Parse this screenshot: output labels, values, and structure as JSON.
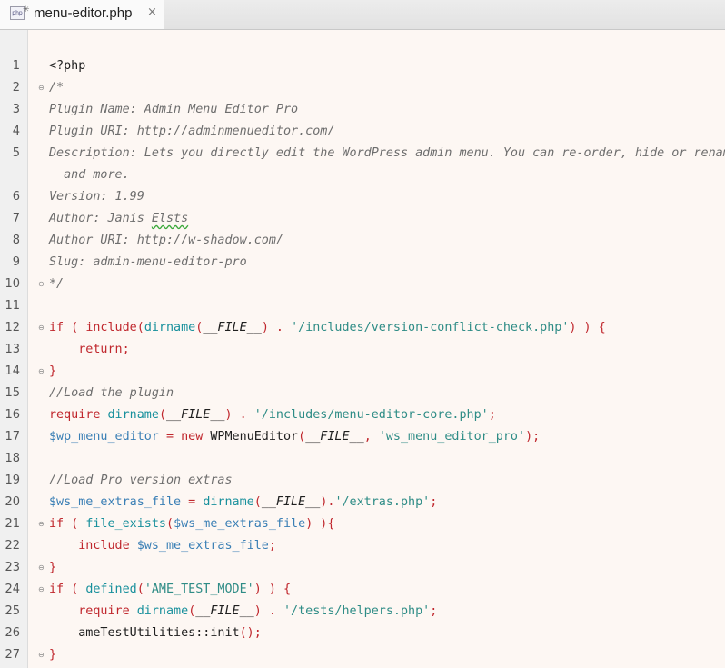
{
  "tab": {
    "title": "menu-editor.php",
    "icon_label": "php",
    "close_glyph": "×"
  },
  "lines": [
    {
      "n": "1",
      "fold": "",
      "tokens": [
        {
          "t": "<?php",
          "c": "plain"
        }
      ]
    },
    {
      "n": "2",
      "fold": "open",
      "tokens": [
        {
          "t": "/*",
          "c": "cm"
        }
      ]
    },
    {
      "n": "3",
      "fold": "",
      "tokens": [
        {
          "t": "Plugin Name: Admin Menu Editor Pro",
          "c": "cm"
        }
      ]
    },
    {
      "n": "4",
      "fold": "",
      "tokens": [
        {
          "t": "Plugin URI: http://adminmenueditor.com/",
          "c": "cm"
        }
      ]
    },
    {
      "n": "5",
      "fold": "",
      "tokens": [
        {
          "t": "Description: Lets you directly edit the WordPress admin menu. You can re-order, hide or renam",
          "c": "cm"
        }
      ]
    },
    {
      "n": "",
      "fold": "",
      "tokens": [
        {
          "t": "  and more.",
          "c": "cm"
        }
      ]
    },
    {
      "n": "6",
      "fold": "",
      "tokens": [
        {
          "t": "Version: 1.99",
          "c": "cm"
        }
      ]
    },
    {
      "n": "7",
      "fold": "",
      "tokens": [
        {
          "t": "Author: Janis ",
          "c": "cm"
        },
        {
          "t": "Elsts",
          "c": "cm squig"
        }
      ]
    },
    {
      "n": "8",
      "fold": "",
      "tokens": [
        {
          "t": "Author URI: http://w-shadow.com/",
          "c": "cm"
        }
      ]
    },
    {
      "n": "9",
      "fold": "",
      "tokens": [
        {
          "t": "Slug: admin-menu-editor-pro",
          "c": "cm"
        }
      ]
    },
    {
      "n": "10",
      "fold": "close",
      "tokens": [
        {
          "t": "*/",
          "c": "cm"
        }
      ]
    },
    {
      "n": "11",
      "fold": "",
      "tokens": []
    },
    {
      "n": "12",
      "fold": "open",
      "tokens": [
        {
          "t": "if ( ",
          "c": "kw"
        },
        {
          "t": "include",
          "c": "kw"
        },
        {
          "t": "(",
          "c": "kw"
        },
        {
          "t": "dirname",
          "c": "fn"
        },
        {
          "t": "(",
          "c": "kw"
        },
        {
          "t": "__FILE__",
          "c": "const"
        },
        {
          "t": ") . ",
          "c": "kw"
        },
        {
          "t": "'/includes/version-conflict-check.php'",
          "c": "str"
        },
        {
          "t": ") ) {",
          "c": "kw"
        }
      ]
    },
    {
      "n": "13",
      "fold": "",
      "tokens": [
        {
          "t": "    return;",
          "c": "kw"
        }
      ]
    },
    {
      "n": "14",
      "fold": "close",
      "tokens": [
        {
          "t": "}",
          "c": "kw"
        }
      ]
    },
    {
      "n": "15",
      "fold": "",
      "tokens": [
        {
          "t": "//Load the plugin",
          "c": "cm"
        }
      ]
    },
    {
      "n": "16",
      "fold": "",
      "tokens": [
        {
          "t": "require ",
          "c": "kw"
        },
        {
          "t": "dirname",
          "c": "fn"
        },
        {
          "t": "(",
          "c": "kw"
        },
        {
          "t": "__FILE__",
          "c": "const"
        },
        {
          "t": ") . ",
          "c": "kw"
        },
        {
          "t": "'/includes/menu-editor-core.php'",
          "c": "str"
        },
        {
          "t": ";",
          "c": "kw"
        }
      ]
    },
    {
      "n": "17",
      "fold": "",
      "tokens": [
        {
          "t": "$wp_menu_editor",
          "c": "var"
        },
        {
          "t": " = ",
          "c": "kw"
        },
        {
          "t": "new ",
          "c": "kw"
        },
        {
          "t": "WPMenuEditor",
          "c": "plain"
        },
        {
          "t": "(",
          "c": "kw"
        },
        {
          "t": "__FILE__",
          "c": "const"
        },
        {
          "t": ", ",
          "c": "kw"
        },
        {
          "t": "'ws_menu_editor_pro'",
          "c": "str"
        },
        {
          "t": ");",
          "c": "kw"
        }
      ]
    },
    {
      "n": "18",
      "fold": "",
      "tokens": []
    },
    {
      "n": "19",
      "fold": "",
      "tokens": [
        {
          "t": "//Load Pro version extras",
          "c": "cm"
        }
      ]
    },
    {
      "n": "20",
      "fold": "",
      "tokens": [
        {
          "t": "$ws_me_extras_file",
          "c": "var"
        },
        {
          "t": " = ",
          "c": "kw"
        },
        {
          "t": "dirname",
          "c": "fn"
        },
        {
          "t": "(",
          "c": "kw"
        },
        {
          "t": "__FILE__",
          "c": "const"
        },
        {
          "t": ").",
          "c": "kw"
        },
        {
          "t": "'/extras.php'",
          "c": "str"
        },
        {
          "t": ";",
          "c": "kw"
        }
      ]
    },
    {
      "n": "21",
      "fold": "open",
      "tokens": [
        {
          "t": "if ( ",
          "c": "kw"
        },
        {
          "t": "file_exists",
          "c": "fn"
        },
        {
          "t": "(",
          "c": "kw"
        },
        {
          "t": "$ws_me_extras_file",
          "c": "var"
        },
        {
          "t": ") ){",
          "c": "kw"
        }
      ]
    },
    {
      "n": "22",
      "fold": "",
      "tokens": [
        {
          "t": "    include ",
          "c": "kw"
        },
        {
          "t": "$ws_me_extras_file",
          "c": "var"
        },
        {
          "t": ";",
          "c": "kw"
        }
      ]
    },
    {
      "n": "23",
      "fold": "close",
      "tokens": [
        {
          "t": "}",
          "c": "kw"
        }
      ]
    },
    {
      "n": "24",
      "fold": "open",
      "tokens": [
        {
          "t": "if ( ",
          "c": "kw"
        },
        {
          "t": "defined",
          "c": "fn"
        },
        {
          "t": "(",
          "c": "kw"
        },
        {
          "t": "'AME_TEST_MODE'",
          "c": "str"
        },
        {
          "t": ") ) {",
          "c": "kw"
        }
      ]
    },
    {
      "n": "25",
      "fold": "",
      "tokens": [
        {
          "t": "    require ",
          "c": "kw"
        },
        {
          "t": "dirname",
          "c": "fn"
        },
        {
          "t": "(",
          "c": "kw"
        },
        {
          "t": "__FILE__",
          "c": "const"
        },
        {
          "t": ") . ",
          "c": "kw"
        },
        {
          "t": "'/tests/helpers.php'",
          "c": "str"
        },
        {
          "t": ";",
          "c": "kw"
        }
      ]
    },
    {
      "n": "26",
      "fold": "",
      "tokens": [
        {
          "t": "    ameTestUtilities::init",
          "c": "plain"
        },
        {
          "t": "();",
          "c": "kw"
        }
      ]
    },
    {
      "n": "27",
      "fold": "close",
      "tokens": [
        {
          "t": "}",
          "c": "kw"
        }
      ]
    }
  ]
}
